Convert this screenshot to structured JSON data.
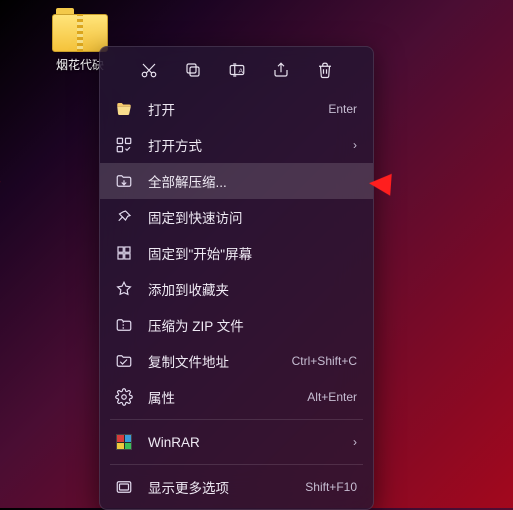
{
  "desktop": {
    "file_label": "烟花代砄"
  },
  "actions": [
    {
      "name": "cut-icon"
    },
    {
      "name": "copy-icon"
    },
    {
      "name": "rename-icon"
    },
    {
      "name": "share-icon"
    },
    {
      "name": "delete-icon"
    }
  ],
  "menu": {
    "items": [
      {
        "icon": "folder-open-icon",
        "label": "打开",
        "shortcut": "Enter"
      },
      {
        "icon": "open-with-icon",
        "label": "打开方式",
        "submenu": true
      },
      {
        "icon": "extract-all-icon",
        "label": "全部解压缩...",
        "highlight": true
      },
      {
        "icon": "pin-icon",
        "label": "固定到快速访问"
      },
      {
        "icon": "pin-start-icon",
        "label": "固定到\"开始\"屏幕"
      },
      {
        "icon": "star-icon",
        "label": "添加到收藏夹"
      },
      {
        "icon": "zip-icon",
        "label": "压缩为 ZIP 文件"
      },
      {
        "icon": "copy-path-icon",
        "label": "复制文件地址",
        "shortcut": "Ctrl+Shift+C"
      },
      {
        "icon": "properties-icon",
        "label": "属性",
        "shortcut": "Alt+Enter"
      },
      {
        "sep": true
      },
      {
        "icon": "winrar-icon",
        "label": "WinRAR",
        "submenu": true
      },
      {
        "sep": true
      },
      {
        "icon": "more-options-icon",
        "label": "显示更多选项",
        "shortcut": "Shift+F10"
      }
    ]
  }
}
